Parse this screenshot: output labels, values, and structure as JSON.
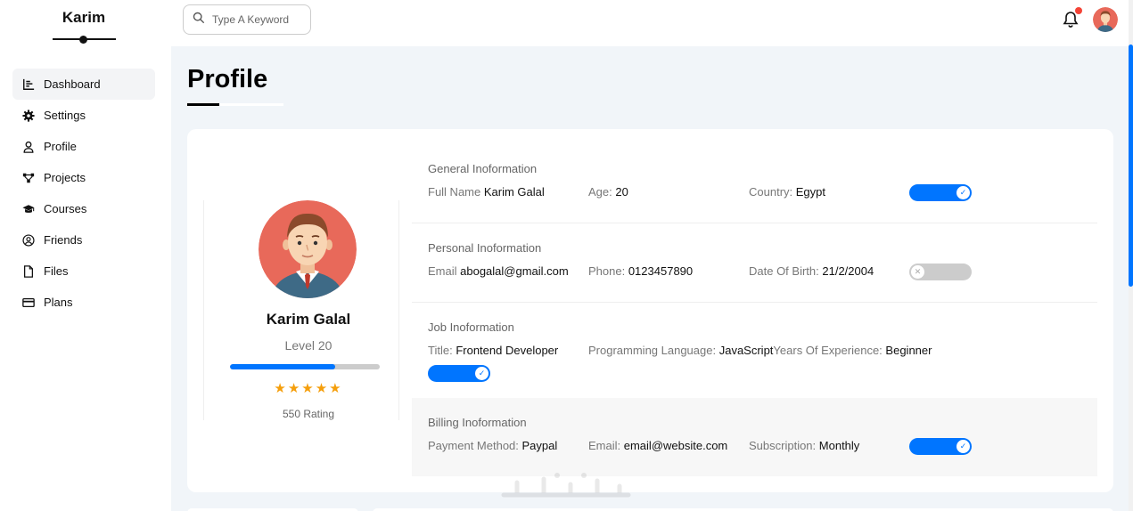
{
  "sidebar": {
    "brand": "Karim",
    "items": [
      {
        "label": "Dashboard",
        "icon": "chart-bar-icon",
        "active": true
      },
      {
        "label": "Settings",
        "icon": "gear-icon"
      },
      {
        "label": "Profile",
        "icon": "user-icon"
      },
      {
        "label": "Projects",
        "icon": "diagram-icon"
      },
      {
        "label": "Courses",
        "icon": "graduation-cap-icon"
      },
      {
        "label": "Friends",
        "icon": "user-circle-icon"
      },
      {
        "label": "Files",
        "icon": "file-icon"
      },
      {
        "label": "Plans",
        "icon": "credit-card-icon"
      }
    ]
  },
  "topbar": {
    "search_placeholder": "Type A Keyword"
  },
  "page": {
    "title": "Profile"
  },
  "profile": {
    "name": "Karim Galal",
    "level": "Level 20",
    "progress": 0.7,
    "stars": "★★★★★",
    "rating": "550 Rating"
  },
  "sections": {
    "general": {
      "title": "General Inoformation",
      "full_name_label": "Full Name",
      "full_name": "Karim Galal",
      "age_label": "Age:",
      "age": "20",
      "country_label": "Country:",
      "country": "Egypt",
      "toggle_on": true
    },
    "personal": {
      "title": "Personal Inoformation",
      "email_label": "Email",
      "email": "abogalal@gmail.com",
      "phone_label": "Phone:",
      "phone": "0123457890",
      "dob_label": "Date Of Birth:",
      "dob": "21/2/2004",
      "toggle_on": false
    },
    "job": {
      "title": "Job Inoformation",
      "title_label": "Title:",
      "job_title": "Frontend Developer",
      "lang_label": "Programming Language:",
      "lang": "JavaScript",
      "exp_label": "Years Of Experience:",
      "exp": "Beginner",
      "toggle_on": true
    },
    "billing": {
      "title": "Billing Inoformation",
      "method_label": "Payment Method:",
      "method": "Paypal",
      "email_label": "Email:",
      "email": "email@website.com",
      "sub_label": "Subscription:",
      "sub": "Monthly",
      "toggle_on": true
    }
  },
  "colors": {
    "accent": "#0075ff",
    "avatar_bg": "#e8695a",
    "star": "#f59e0b",
    "notification": "#f44336"
  }
}
